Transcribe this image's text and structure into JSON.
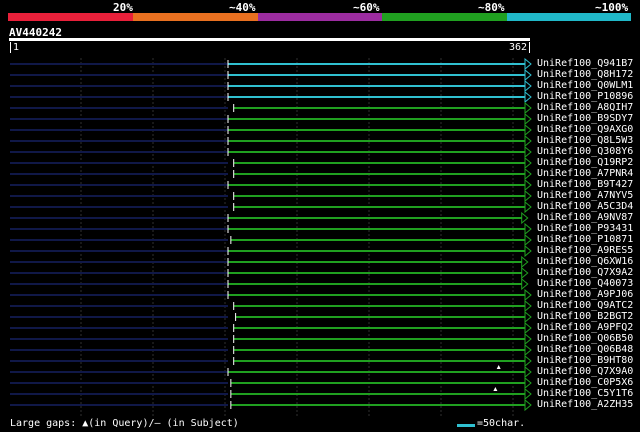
{
  "legend": {
    "colors": [
      "#e8203a",
      "#e87020",
      "#9c2ca0",
      "#20a020",
      "#20b8c8"
    ],
    "labels": [
      "20%",
      "~40%",
      "~60%",
      "~80%",
      "~100%"
    ]
  },
  "query": {
    "id": "AV440242",
    "start": "1",
    "end": "362"
  },
  "colors": {
    "cyan": "#30c0d0",
    "green": "#20a020",
    "navy": "#101848",
    "grid": "#303030"
  },
  "hits": [
    {
      "name": "UniRef100_Q941B7",
      "color": "cyan",
      "start": 1,
      "end": 362
    },
    {
      "name": "UniRef100_Q8H172",
      "color": "cyan",
      "start": 1,
      "end": 362
    },
    {
      "name": "UniRef100_Q0WLM1",
      "color": "cyan",
      "start": 1,
      "end": 362
    },
    {
      "name": "UniRef100_P10896",
      "color": "cyan",
      "start": 1,
      "end": 362
    },
    {
      "name": "UniRef100_A8QIH7",
      "color": "green",
      "start": 7,
      "end": 362
    },
    {
      "name": "UniRef100_B9SDY7",
      "color": "green",
      "start": 1,
      "end": 362
    },
    {
      "name": "UniRef100_Q9AXG0",
      "color": "green",
      "start": 1,
      "end": 362
    },
    {
      "name": "UniRef100_Q8L5W3",
      "color": "green",
      "start": 1,
      "end": 362
    },
    {
      "name": "UniRef100_Q308Y6",
      "color": "green",
      "start": 1,
      "end": 362
    },
    {
      "name": "UniRef100_Q19RP2",
      "color": "green",
      "start": 7,
      "end": 362
    },
    {
      "name": "UniRef100_A7PNR4",
      "color": "green",
      "start": 7,
      "end": 362
    },
    {
      "name": "UniRef100_B9T427",
      "color": "green",
      "start": 1,
      "end": 362
    },
    {
      "name": "UniRef100_A7NYV5",
      "color": "green",
      "start": 7,
      "end": 362
    },
    {
      "name": "UniRef100_A5C3D4",
      "color": "green",
      "start": 7,
      "end": 362
    },
    {
      "name": "UniRef100_A9NV87",
      "color": "green",
      "start": 1,
      "end": 358
    },
    {
      "name": "UniRef100_P93431",
      "color": "green",
      "start": 1,
      "end": 362
    },
    {
      "name": "UniRef100_P10871",
      "color": "green",
      "start": 4,
      "end": 362
    },
    {
      "name": "UniRef100_A9RES5",
      "color": "green",
      "start": 1,
      "end": 362
    },
    {
      "name": "UniRef100_Q6XW16",
      "color": "green",
      "start": 1,
      "end": 358
    },
    {
      "name": "UniRef100_Q7X9A2",
      "color": "green",
      "start": 1,
      "end": 358
    },
    {
      "name": "UniRef100_Q40073",
      "color": "green",
      "start": 1,
      "end": 358
    },
    {
      "name": "UniRef100_A9PJ06",
      "color": "green",
      "start": 1,
      "end": 362
    },
    {
      "name": "UniRef100_Q9ATC2",
      "color": "green",
      "start": 7,
      "end": 362
    },
    {
      "name": "UniRef100_B2BGT2",
      "color": "green",
      "start": 9,
      "end": 362
    },
    {
      "name": "UniRef100_A9PFQ2",
      "color": "green",
      "start": 7,
      "end": 362
    },
    {
      "name": "UniRef100_Q06B50",
      "color": "green",
      "start": 7,
      "end": 362
    },
    {
      "name": "UniRef100_Q06B48",
      "color": "green",
      "start": 7,
      "end": 362
    },
    {
      "name": "UniRef100_B9HT80",
      "color": "green",
      "start": 7,
      "end": 362
    },
    {
      "name": "UniRef100_Q7X9A0",
      "color": "green",
      "start": 1,
      "end": 362,
      "gap": 330
    },
    {
      "name": "UniRef100_C0P5X6",
      "color": "green",
      "start": 4,
      "end": 362
    },
    {
      "name": "UniRef100_C5Y1T6",
      "color": "green",
      "start": 4,
      "end": 362,
      "gap": 326
    },
    {
      "name": "UniRef100_A2ZH35",
      "color": "green",
      "start": 4,
      "end": 362
    }
  ],
  "footer": {
    "gaps_text": "Large gaps: ▲(in Query)/— (in Subject)",
    "scale_text": "=50char."
  }
}
